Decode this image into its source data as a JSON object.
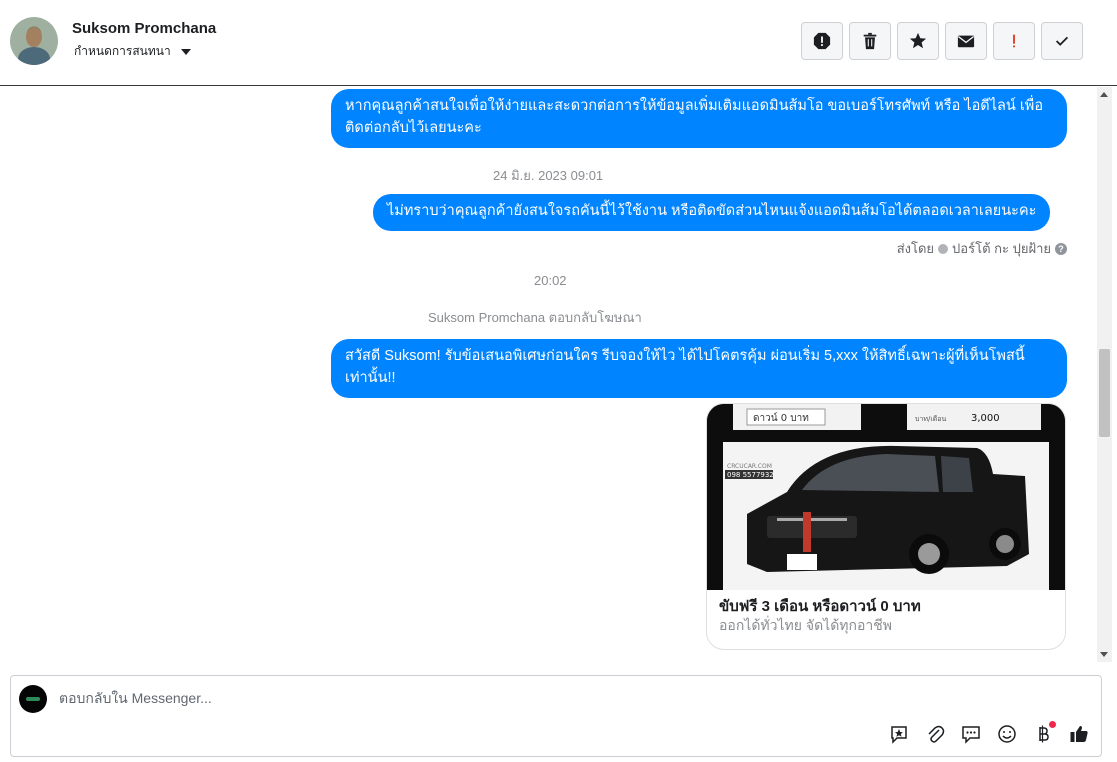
{
  "header": {
    "contact_name": "Suksom Promchana",
    "assign_label": "กำหนดการสนทนา",
    "tools": [
      "spam-icon",
      "trash-icon",
      "star-icon",
      "envelope-icon",
      "follow-up-icon",
      "check-icon"
    ]
  },
  "messages": {
    "msg1": "หากคุณลูกค้าสนใจเพื่อให้ง่ายและสะดวกต่อการให้ข้อมูลเพิ่มเติมแอดมินส้มโอ ขอเบอร์โทรศัพท์ หรือ ไอดีไลน์ เพื่อติดต่อกลับไว้เลยนะคะ",
    "timestamp1": "24 มิ.ย. 2023 09:01",
    "msg2": "ไม่ทราบว่าคุณลูกค้ายังสนใจรถคันนี้ไว้ใช้งาน หรือติดขัดส่วนไหนแจ้งแอดมินส้มโอได้ตลอดเวลาเลยนะคะ",
    "sent_by_label": "ส่งโดย",
    "sent_by_name": "ปอร์โต้ กะ ปุยฝ้าย",
    "timestamp2": "20:02",
    "reply_context": "Suksom Promchana ตอบกลับโฆษณา",
    "msg3": "สวัสดี Suksom! รับข้อเสนอพิเศษก่อนใคร รีบจองให้ไว ได้ไปโคตรคุ้ม ผ่อนเริ่ม 5,xxx  ให้สิทธิ์เฉพาะผู้ที่เห็นโพสนี้เท่านั้น!!",
    "card_title": "ขับฟรี 3 เดือน หรือดาวน์ 0 บาท",
    "card_subtitle": "ออกได้ทั่วไทย จัดได้ทุกอาชีพ",
    "card_image_texts": {
      "down": "ดาวน์ 0 บาท",
      "installment": "3,000",
      "installment_tail": "บาท/เดือน",
      "brand": "CRCUCAR.COM",
      "phone": "098 5577932"
    }
  },
  "composer": {
    "placeholder": "ตอบกลับใน Messenger...",
    "icons": [
      "saved-reply-icon",
      "attachment-icon",
      "chat-icon",
      "emoji-icon",
      "baht-payment-icon",
      "like-icon"
    ]
  },
  "colors": {
    "bubble": "#0084ff",
    "alert_red": "#e0321c"
  }
}
